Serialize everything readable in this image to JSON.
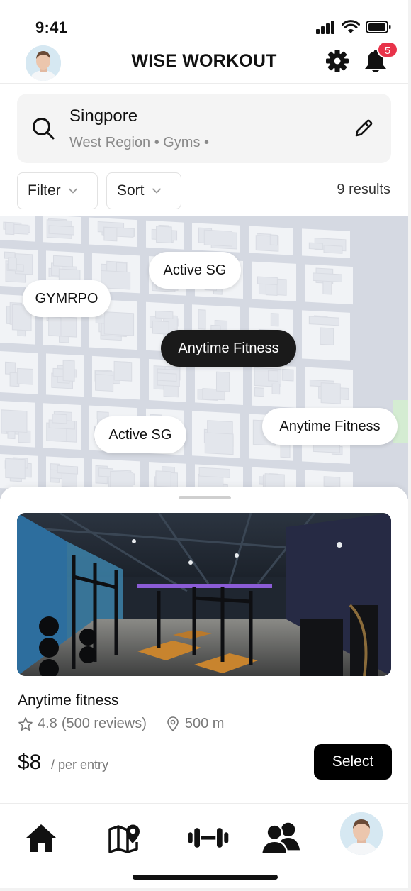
{
  "status_bar": {
    "time": "9:41"
  },
  "header": {
    "title": "WISE WORKOUT",
    "notification_count": "5"
  },
  "search": {
    "location": "Singpore",
    "subtitle": "West Region • Gyms •"
  },
  "filters": {
    "filter_label": "Filter",
    "sort_label": "Sort",
    "results": "9 results"
  },
  "map_pins": [
    {
      "label": "Active SG",
      "active": false
    },
    {
      "label": "GYMRPO",
      "active": false
    },
    {
      "label": "Anytime Fitness",
      "active": true
    },
    {
      "label": "Active SG",
      "active": false
    },
    {
      "label": "Anytime Fitness",
      "active": false
    }
  ],
  "gym_card": {
    "name": "Anytime fitness",
    "rating": "4.8",
    "reviews": "(500 reviews)",
    "distance": "500 m",
    "price": "$8",
    "price_unit": "/ per entry",
    "select_label": "Select"
  },
  "tab_bar": {
    "items": [
      {
        "icon": "home-icon"
      },
      {
        "icon": "map-pin-icon"
      },
      {
        "icon": "dumbbell-icon"
      },
      {
        "icon": "people-icon"
      },
      {
        "icon": "profile-avatar"
      }
    ]
  }
}
